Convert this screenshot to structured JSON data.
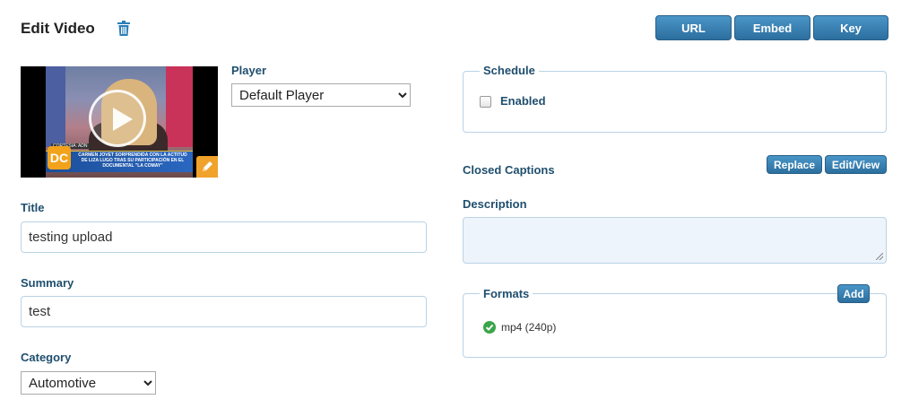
{
  "header": {
    "title": "Edit Video",
    "buttons": {
      "url": "URL",
      "embed": "Embed",
      "key": "Key"
    }
  },
  "thumbnail": {
    "logo_text": "DC",
    "courtesy": "CORTESIA: ADN",
    "caption": "CARMEN JOVET SORPRENDIDA CON LA ACTITUD DE LIZA LUGO TRAS SU PARTICIPACIÓN EN EL DOCUMENTAL \"LA COMAY\""
  },
  "player": {
    "label": "Player",
    "selected": "Default Player",
    "options": [
      "Default Player"
    ]
  },
  "title_field": {
    "label": "Title",
    "value": "testing upload"
  },
  "summary_field": {
    "label": "Summary",
    "value": "test"
  },
  "category": {
    "label": "Category",
    "selected": "Automotive",
    "options": [
      "Automotive"
    ]
  },
  "schedule": {
    "legend": "Schedule",
    "enabled_label": "Enabled",
    "enabled": false
  },
  "closed_captions": {
    "label": "Closed Captions",
    "replace_label": "Replace",
    "editview_label": "Edit/View"
  },
  "description": {
    "label": "Description",
    "value": ""
  },
  "formats": {
    "legend": "Formats",
    "add_label": "Add",
    "items": [
      {
        "name": "mp4 (240p)",
        "status": "ok"
      }
    ]
  },
  "colors": {
    "accent": "#2c6f9f",
    "label": "#1f4e6e",
    "success": "#3aa54a",
    "edit_badge": "#f0a22a"
  }
}
